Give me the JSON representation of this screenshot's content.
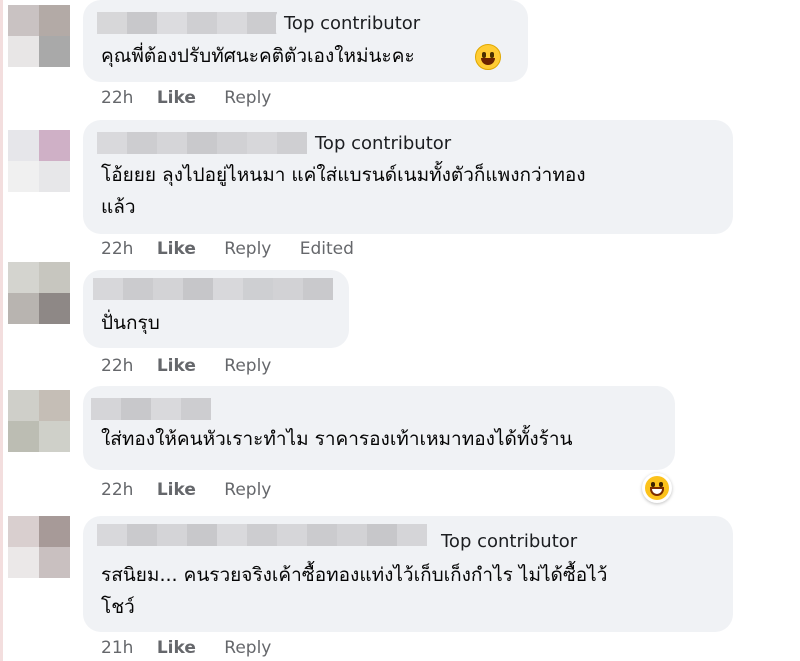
{
  "comments": [
    {
      "badge": "Top contributor",
      "text_lines": [
        "คุณพี่ต้องปรับทัศนะคติตัวเองใหม่นะคะ"
      ],
      "emoji": "grinning-sweat-emoji",
      "time": "22h",
      "like": "Like",
      "reply": "Reply",
      "edited": ""
    },
    {
      "badge": "Top contributor",
      "text_lines": [
        "โอ้ยยย ลุงไปอยู่ไหนมา แค่ใส่แบรนด์เนมทั้งตัวก็แพงกว่าทอง",
        "แล้ว"
      ],
      "time": "22h",
      "like": "Like",
      "reply": "Reply",
      "edited": "Edited"
    },
    {
      "badge": "",
      "text_lines": [
        "ปั่นกรุบ"
      ],
      "time": "22h",
      "like": "Like",
      "reply": "Reply",
      "edited": ""
    },
    {
      "badge": "",
      "text_lines": [
        "ใส่ทองให้คนหัวเราะทำไม ราคารองเท้าเหมาทองได้ทั้งร้าน"
      ],
      "reaction": "haha-reaction-icon",
      "time": "22h",
      "like": "Like",
      "reply": "Reply",
      "edited": ""
    },
    {
      "badge": "Top contributor",
      "text_lines": [
        "รสนิยม... คนรวยจริงเค้าซื้อทองแท่งไว้เก็บเก็งกำไร ไม่ได้ซื้อไว้",
        "โชว์"
      ],
      "time": "21h",
      "like": "Like",
      "reply": "Reply",
      "edited": ""
    }
  ],
  "colors": {
    "bubble": "#f0f2f5",
    "meta_text": "#65676b",
    "body_text": "#050505"
  }
}
